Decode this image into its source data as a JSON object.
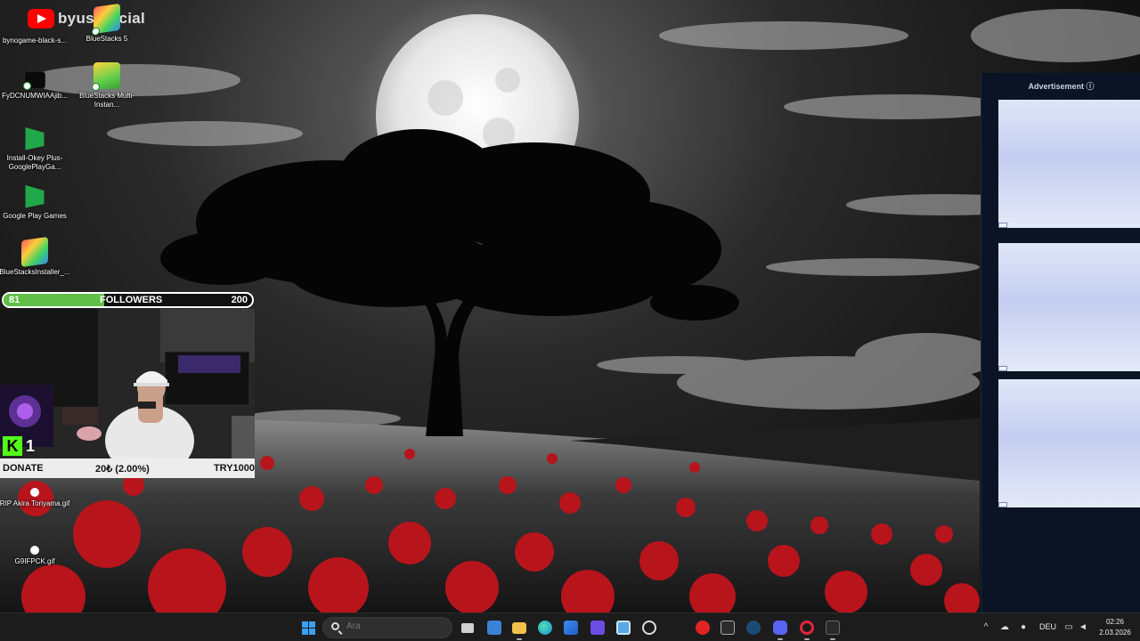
{
  "overlay": {
    "channel_name": "byusofficial",
    "followers": {
      "current": "81",
      "label": "FOLLOWERS",
      "goal": "200",
      "progress": 0.405
    },
    "donate": {
      "label": "DONATE",
      "progress": "20₺ (2.00%)",
      "goal": "TRY1000"
    },
    "kick_viewers": "1"
  },
  "desktop": {
    "icons": [
      {
        "label": "bynogame-black-s...",
        "icon": "blackbox-file-icon"
      },
      {
        "label": "BlueStacks 5",
        "icon": "bluestacks-icon"
      },
      {
        "label": "FyDCNUMWIAAjib...",
        "icon": "image-file-icon"
      },
      {
        "label": "BlueStacks Multi-Instan...",
        "icon": "bluestacks-multi-icon"
      },
      {
        "label": "Install-Okey Plus-GooglePlayGa...",
        "icon": "google-play-games-icon"
      },
      {
        "label": "Google Play Games",
        "icon": "google-play-games-icon"
      },
      {
        "label": "BlueStacksInstaller_...",
        "icon": "bluestacks-installer-icon"
      },
      {
        "label": "RIP Akira Toriyama.gif",
        "icon": "gif-file-icon"
      },
      {
        "label": "G9IFPCK.gif",
        "icon": "gif-file-icon"
      }
    ]
  },
  "ad_panel": {
    "header": "Advertisement ⓘ"
  },
  "taskbar": {
    "search_placeholder": "Ara",
    "apps": [
      "start",
      "search",
      "task-view",
      "widgets",
      "file-explorer",
      "edge",
      "store",
      "app-grid",
      "photos",
      "chatgpt",
      "roblox",
      "epic-games",
      "steam",
      "discord",
      "opera-gx",
      "obs"
    ],
    "language": "DEU",
    "time": "02:26",
    "date": "2.03.2026"
  },
  "colors": {
    "followers_fill": "#5fbf48",
    "kick": "#53fc18",
    "ad_bg": "#0b1424"
  }
}
